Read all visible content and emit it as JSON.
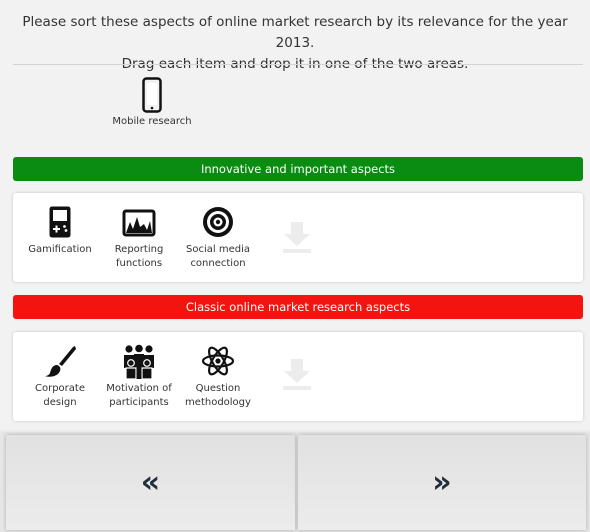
{
  "question": {
    "line1": "Please sort these aspects of online market research by its relevance for the year 2013.",
    "line2": "Drag each item and drop it in one of the two areas."
  },
  "pool": {
    "items": [
      {
        "icon": "mobile-phone-icon",
        "label_lines": [
          "Mobile research"
        ]
      }
    ]
  },
  "zones": [
    {
      "title": "Innovative and important aspects",
      "color": "#0a8b12",
      "items": [
        {
          "icon": "game-console-icon",
          "label_lines": [
            "Gamification"
          ]
        },
        {
          "icon": "chart-icon",
          "label_lines": [
            "Reporting",
            "functions"
          ]
        },
        {
          "icon": "target-icon",
          "label_lines": [
            "Social media",
            "connection"
          ]
        }
      ],
      "drop_icon": "download-arrow-icon"
    },
    {
      "title": "Classic online market research aspects",
      "color": "#f3140f",
      "items": [
        {
          "icon": "paintbrush-icon",
          "label_lines": [
            "Corporate",
            "design"
          ]
        },
        {
          "icon": "people-group-icon",
          "label_lines": [
            "Motivation of",
            "participants"
          ]
        },
        {
          "icon": "atom-icon",
          "label_lines": [
            "Question",
            "methodology"
          ]
        }
      ],
      "drop_icon": "download-arrow-icon"
    }
  ],
  "navigation": {
    "back_label": "«",
    "next_label": "»"
  }
}
